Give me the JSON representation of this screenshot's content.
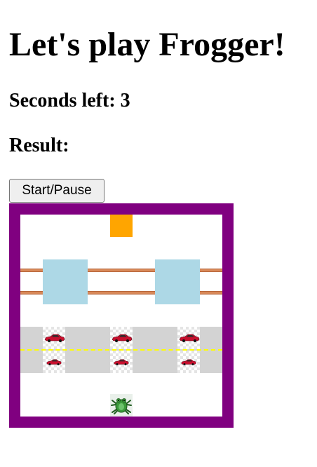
{
  "title": "Let's play Frogger!",
  "seconds_label": "Seconds left: 3",
  "result_label": "Result:",
  "start_pause_label": "Start/Pause",
  "colors": {
    "board_border": "#800080",
    "goal": "#ffa500",
    "water": "#add8e6",
    "road": "#d3d3d3",
    "lane_line": "#ffff00"
  },
  "icons": {
    "car": "red-car-icon",
    "frog": "frog-icon",
    "log": "log-icon"
  }
}
